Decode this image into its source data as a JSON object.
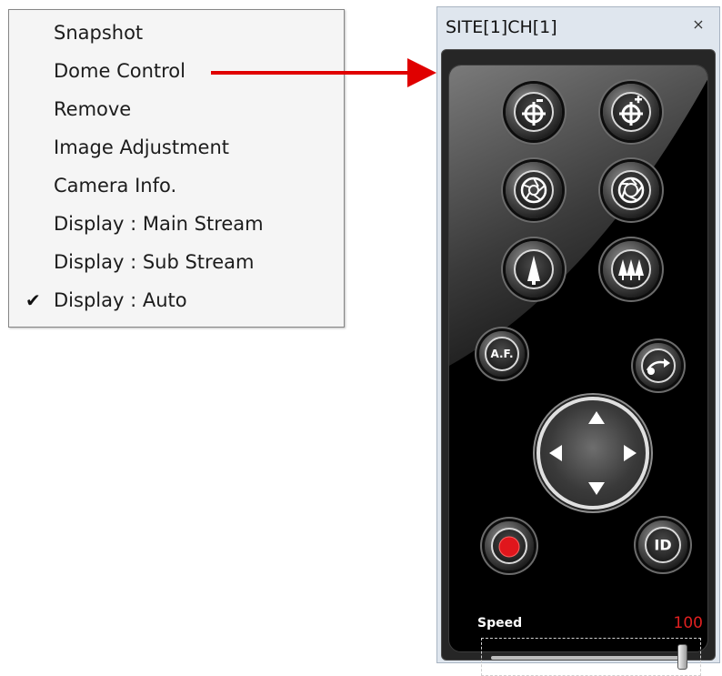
{
  "menu": {
    "items": [
      {
        "label": "Snapshot",
        "checked": false
      },
      {
        "label": "Dome Control",
        "checked": false
      },
      {
        "label": "Remove",
        "checked": false
      },
      {
        "label": "Image Adjustment",
        "checked": false
      },
      {
        "label": "Camera Info.",
        "checked": false
      },
      {
        "label": "Display : Main Stream",
        "checked": false
      },
      {
        "label": "Display : Sub Stream",
        "checked": false
      },
      {
        "label": "Display : Auto",
        "checked": true
      }
    ],
    "check_glyph": "✔"
  },
  "arrow": {
    "color": "#e00000",
    "points_from": "Dome Control"
  },
  "dome": {
    "title": "SITE[1]CH[1]",
    "close_icon": "close-icon",
    "buttons": {
      "zoom_out": {
        "icon": "zoom-out-icon"
      },
      "zoom_in": {
        "icon": "zoom-in-icon"
      },
      "iris_close": {
        "icon": "iris-close-icon"
      },
      "iris_open": {
        "icon": "iris-open-icon"
      },
      "focus_near": {
        "icon": "focus-near-icon"
      },
      "focus_far": {
        "icon": "focus-far-icon"
      },
      "auto_focus": {
        "label": "A.F."
      },
      "preset": {
        "icon": "preset-icon"
      },
      "record": {
        "icon": "record-icon"
      },
      "id": {
        "label": "ID"
      }
    },
    "speed": {
      "label": "Speed",
      "value": "100",
      "level": 1.0
    },
    "colors": {
      "record_dot": "#e0161c",
      "speed_value": "#e02020"
    }
  }
}
